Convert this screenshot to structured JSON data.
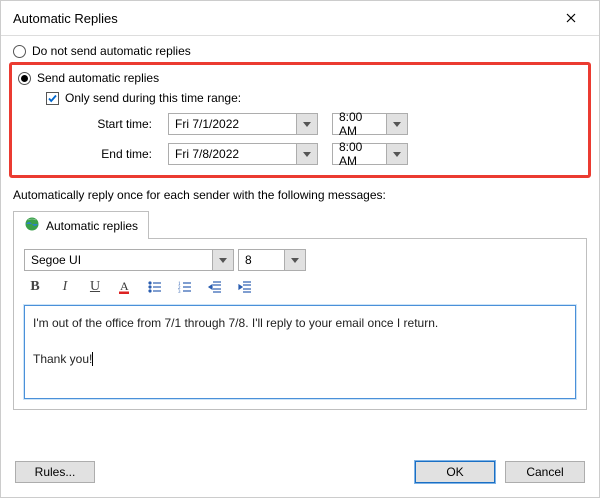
{
  "title": "Automatic Replies",
  "options": {
    "do_not_send": "Do not send automatic replies",
    "send_auto": "Send automatic replies",
    "only_during": "Only send during this time range:",
    "start_label": "Start time:",
    "end_label": "End time:",
    "start_date": "Fri 7/1/2022",
    "start_time": "8:00 AM",
    "end_date": "Fri 7/8/2022",
    "end_time": "8:00 AM"
  },
  "section_label": "Automatically reply once for each sender with the following messages:",
  "tab_label": "Automatic replies",
  "font": {
    "family": "Segoe UI",
    "size": "8"
  },
  "message_line1": "I'm out of the office from 7/1 through 7/8. I'll reply to your email once I return.",
  "message_line2": "Thank you!",
  "buttons": {
    "rules": "Rules...",
    "ok": "OK",
    "cancel": "Cancel"
  }
}
